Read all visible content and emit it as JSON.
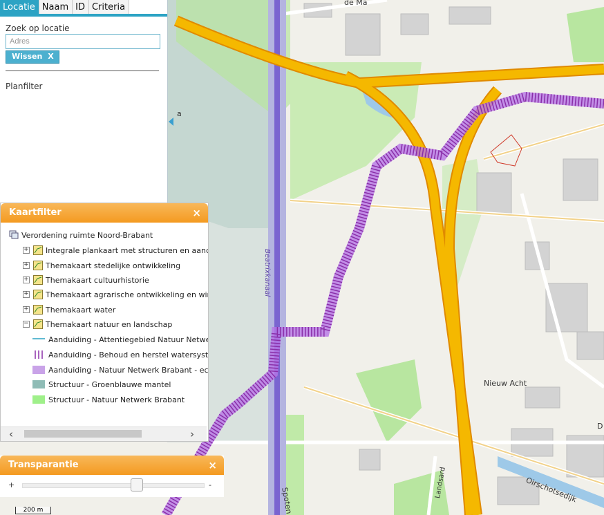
{
  "tabs": [
    "Locatie",
    "Naam",
    "ID",
    "Criteria"
  ],
  "search": {
    "label": "Zoek op locatie",
    "placeholder": "Adres",
    "clear_label": "Wissen",
    "clear_icon": "X"
  },
  "planfilter_label": "Planfilter",
  "kaartfilter": {
    "title": "Kaartfilter",
    "close": "×",
    "root": "Verordening ruimte Noord-Brabant",
    "layers": [
      {
        "label": "Integrale plankaart met structuren en aanduidingen",
        "expander": "+"
      },
      {
        "label": "Themakaart stedelijke ontwikkeling",
        "expander": "+"
      },
      {
        "label": "Themakaart cultuurhistorie",
        "expander": "+"
      },
      {
        "label": "Themakaart agrarische ontwikkeling en windturbines",
        "expander": "+"
      },
      {
        "label": "Themakaart water",
        "expander": "+"
      },
      {
        "label": "Themakaart natuur en landschap",
        "expander": "−"
      }
    ],
    "legend": [
      {
        "label": "Aanduiding - Attentiegebied Natuur Netwerk Brabant",
        "type": "line",
        "color": "#2ca3c4"
      },
      {
        "label": "Aanduiding - Behoud en herstel watersystemen",
        "type": "hatch",
        "color": "#8a2fa8"
      },
      {
        "label": "Aanduiding - Natuur Netwerk Brabant - ecologische verbindingszone",
        "type": "fill",
        "color": "#c9a3e8"
      },
      {
        "label": "Structuur - Groenblauwe mantel",
        "type": "fill",
        "color": "#8fbcb6"
      },
      {
        "label": "Structuur - Natuur Netwerk Brabant",
        "type": "fill",
        "color": "#9ff08a"
      }
    ]
  },
  "transparantie": {
    "title": "Transparantie",
    "close": "×",
    "plus": "+",
    "minus": "-",
    "level": 0.63
  },
  "map": {
    "labels": [
      "de Ma",
      "Beatrixkanaal",
      "Nieuw Acht",
      "Oirschotsedijk",
      "Landsard",
      "Spoten",
      "D",
      "a"
    ],
    "scale": "200 m"
  },
  "colors": {
    "accent": "#2ca3c4",
    "panel_header": "#f49a20",
    "motorway": "#f5b800"
  }
}
